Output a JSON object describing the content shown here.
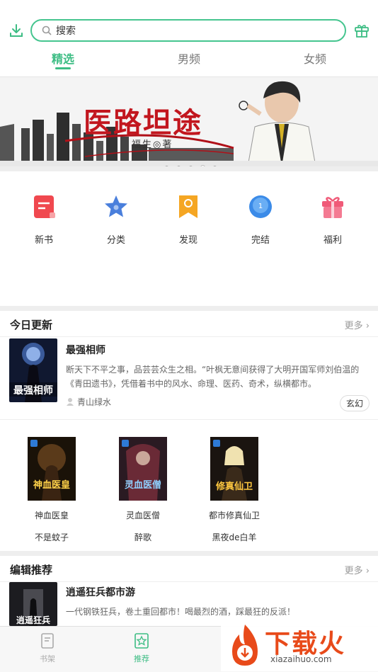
{
  "search": {
    "placeholder": "搜索"
  },
  "tabs": [
    {
      "label": "精选",
      "active": true
    },
    {
      "label": "男频",
      "active": false
    },
    {
      "label": "女频",
      "active": false
    }
  ],
  "banner": {
    "title": "医路坦途",
    "author": "福生◎著"
  },
  "categories": [
    {
      "label": "新书",
      "icon": "new-book-icon",
      "color": "#f0484f"
    },
    {
      "label": "分类",
      "icon": "category-star-icon",
      "color": "#4a7fdc"
    },
    {
      "label": "发现",
      "icon": "discover-bookmark-icon",
      "color": "#f5a623"
    },
    {
      "label": "完结",
      "icon": "finished-circle-icon",
      "color": "#3b8be8"
    },
    {
      "label": "福利",
      "icon": "gift-icon",
      "color": "#f05a78"
    }
  ],
  "today": {
    "title": "今日更新",
    "more": "更多",
    "featured": {
      "title": "最强相师",
      "desc": "断天下不平之事，品芸芸众生之相。“叶枫无意间获得了大明开国军师刘伯温的《青田遗书》，凭借着书中的风水、命理、医药、奇术，纵横都市。",
      "author": "青山绿水",
      "tag": "玄幻",
      "cover_text": "最强相师"
    },
    "books": [
      {
        "title": "神血医皇",
        "author": "不是蚊子",
        "cover_text": "神血医皇"
      },
      {
        "title": "灵血医僧",
        "author": "醉歌",
        "cover_text": "灵血医僧"
      },
      {
        "title": "都市修真仙卫",
        "author": "黑夜de白羊",
        "cover_text": "修真仙卫"
      }
    ]
  },
  "editor": {
    "title": "编辑推荐",
    "more": "更多",
    "featured": {
      "title": "逍遥狂兵都市游",
      "desc": "一代钢铁狂兵，卷土重回都市！喝最烈的酒，踩最狂的反派！",
      "cover_text": "逍遥狂兵"
    }
  },
  "bottom_nav": [
    {
      "label": "书架",
      "icon": "bookshelf-icon",
      "active": false
    },
    {
      "label": "推荐",
      "icon": "recommend-icon",
      "active": true
    }
  ],
  "watermark": {
    "brand": "下载火",
    "url": "xiazaihuo.com"
  },
  "colors": {
    "accent": "#3dbd84"
  }
}
